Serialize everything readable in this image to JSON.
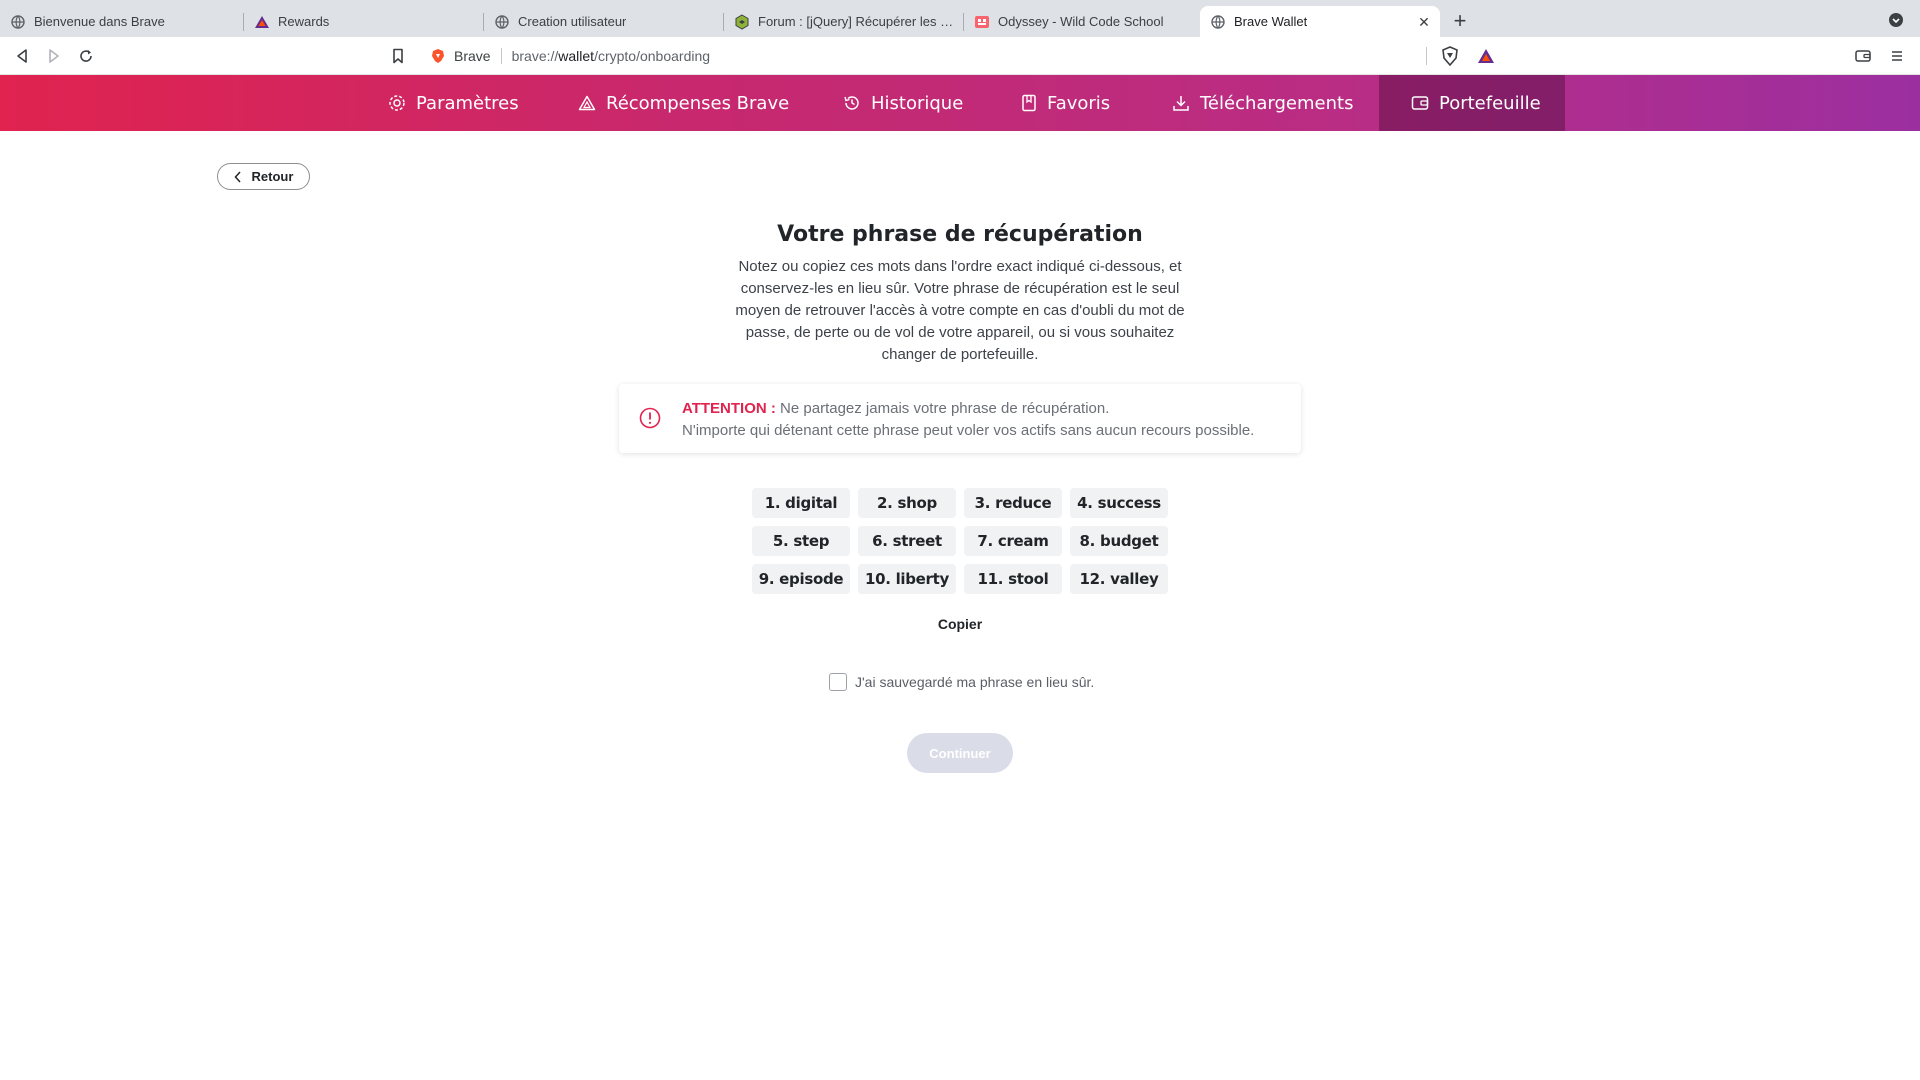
{
  "browser": {
    "tabs": [
      {
        "title": "Bienvenue dans Brave",
        "icon": "globe-icon"
      },
      {
        "title": "Rewards",
        "icon": "bat-icon"
      },
      {
        "title": "Creation utilisateur",
        "icon": "globe-icon"
      },
      {
        "title": "Forum : [jQuery] Récupérer les don",
        "icon": "forum-icon"
      },
      {
        "title": "Odyssey - Wild Code School",
        "icon": "odyssey-icon"
      },
      {
        "title": "Brave Wallet",
        "icon": "globe-icon",
        "active": true
      }
    ],
    "new_tab_label": "+",
    "close_tab_label": "✕",
    "omnibox": {
      "brand": "Brave",
      "url_prefix": "brave://",
      "url_host": "wallet",
      "url_path": "/crypto/onboarding"
    }
  },
  "nav": {
    "items": [
      {
        "label": "Paramètres",
        "icon": "gear-icon"
      },
      {
        "label": "Récompenses Brave",
        "icon": "rewards-triangle-icon"
      },
      {
        "label": "Historique",
        "icon": "history-icon"
      },
      {
        "label": "Favoris",
        "icon": "bookmark-book-icon"
      },
      {
        "label": "Téléchargements",
        "icon": "download-icon"
      },
      {
        "label": "Portefeuille",
        "icon": "wallet-icon",
        "active": true
      }
    ]
  },
  "page": {
    "back_label": "Retour",
    "title": "Votre phrase de récupération",
    "description": "Notez ou copiez ces mots dans l'ordre exact indiqué ci-dessous, et conservez-les en lieu sûr. Votre phrase de récupération est le seul moyen de retrouver l'accès à votre compte en cas d'oubli du mot de passe, de perte ou de vol de votre appareil, ou si vous souhaitez changer de portefeuille.",
    "warning": {
      "label": "ATTENTION :",
      "line1": "Ne partagez jamais votre phrase de récupération.",
      "line2": "N'importe qui détenant cette phrase peut voler vos actifs sans aucun recours possible."
    },
    "words": [
      "1. digital",
      "2. shop",
      "3. reduce",
      "4. success",
      "5. step",
      "6. street",
      "7. cream",
      "8. budget",
      "9. episode",
      "10. liberty",
      "11. stool",
      "12. valley"
    ],
    "copy_label": "Copier",
    "ack_label": "J'ai sauvegardé ma phrase en lieu sûr.",
    "continue_label": "Continuer"
  },
  "colors": {
    "accent": "#e0234f",
    "nav_gradient_start": "#e0234f",
    "nav_gradient_end": "#9c2fa0",
    "disabled_button": "#dadce8"
  }
}
